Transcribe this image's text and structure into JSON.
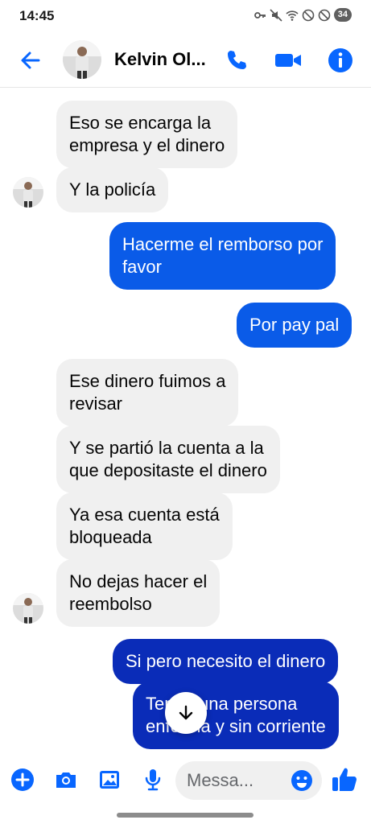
{
  "status_bar": {
    "time": "14:45",
    "battery": "34"
  },
  "header": {
    "contact_name": "Kelvin Ol...",
    "accent": "#0866ff"
  },
  "messages": [
    {
      "side": "in",
      "text_lines": [
        "Eso se encarga la",
        "empresa y el dinero"
      ]
    },
    {
      "side": "in",
      "text_lines": [
        "Y la policía"
      ]
    },
    {
      "side": "out",
      "text_lines": [
        "Hacerme el remborso por",
        "favor"
      ]
    },
    {
      "side": "out",
      "text_lines": [
        "Por pay pal"
      ]
    },
    {
      "side": "in",
      "text_lines": [
        "Ese dinero fuimos a",
        "revisar"
      ]
    },
    {
      "side": "in",
      "text_lines": [
        "Y se partió la cuenta a la",
        "que depositaste el dinero"
      ]
    },
    {
      "side": "in",
      "text_lines": [
        "Ya esa cuenta está",
        "bloqueada"
      ]
    },
    {
      "side": "in",
      "text_lines": [
        "No dejas hacer el",
        "reembolso"
      ]
    },
    {
      "side": "out",
      "text_lines": [
        "Si pero necesito el dinero"
      ]
    },
    {
      "side": "out",
      "text_lines": [
        "Tengo una persona",
        "enferma y sin corriente"
      ]
    }
  ],
  "composer": {
    "placeholder": "Messa..."
  },
  "icons": {
    "back": "arrow-left-icon",
    "call": "phone-icon",
    "video": "video-camera-icon",
    "info": "info-icon",
    "plus": "plus-icon",
    "camera": "camera-icon",
    "gallery": "image-icon",
    "mic": "microphone-icon",
    "emoji": "emoji-icon",
    "like": "thumbs-up-icon",
    "scroll": "arrow-down-icon"
  },
  "colors": {
    "incoming_bubble": "#f0f0f0",
    "outgoing_bubble": "#0a5be8",
    "outgoing_bubble_latest": "#0a2cb8"
  }
}
